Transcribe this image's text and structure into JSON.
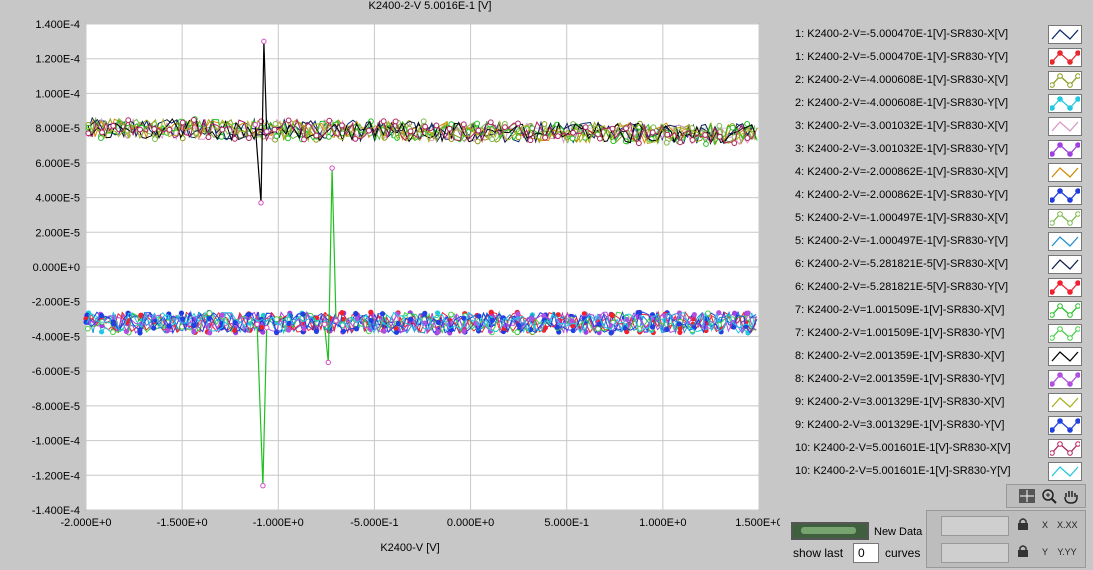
{
  "chart_data": {
    "type": "line",
    "title": "K2400-2-V 5.0016E-1 [V]",
    "xlabel": "K2400-V  [V]",
    "ylabel": "",
    "xlim": [
      -2.0,
      1.5
    ],
    "ylim": [
      -0.00014,
      0.00014
    ],
    "grid": true,
    "x_ticks": [
      "-2.000E+0",
      "-1.500E+0",
      "-1.000E+0",
      "-5.000E-1",
      "0.000E+0",
      "5.000E-1",
      "1.000E+0",
      "1.500E+0"
    ],
    "y_ticks": [
      "1.400E-4",
      "1.200E-4",
      "1.000E-4",
      "8.000E-5",
      "6.000E-5",
      "4.000E-5",
      "2.000E-5",
      "0.000E+0",
      "-2.000E-5",
      "-4.000E-5",
      "-6.000E-5",
      "-8.000E-5",
      "-1.000E-4",
      "-1.200E-4",
      "-1.400E-4"
    ],
    "series": [
      {
        "name": "1: K2400-2-V=-5.000470E-1[V]-SR830-X[V]",
        "color": "#0a2a6e",
        "marker": "none",
        "base": 8e-05
      },
      {
        "name": "1: K2400-2-V=-5.000470E-1[V]-SR830-Y[V]",
        "color": "#e8282c",
        "marker": "dot",
        "base": -3.2e-05
      },
      {
        "name": "2: K2400-2-V=-4.000608E-1[V]-SR830-X[V]",
        "color": "#8a9a16",
        "marker": "ring",
        "base": 8e-05
      },
      {
        "name": "2: K2400-2-V=-4.000608E-1[V]-SR830-Y[V]",
        "color": "#22c8e0",
        "marker": "dot",
        "base": -3.2e-05
      },
      {
        "name": "3: K2400-2-V=-3.001032E-1[V]-SR830-X[V]",
        "color": "#d89ac8",
        "marker": "none",
        "base": 8e-05
      },
      {
        "name": "3: K2400-2-V=-3.001032E-1[V]-SR830-Y[V]",
        "color": "#a040e0",
        "marker": "dot",
        "base": -3.2e-05
      },
      {
        "name": "4: K2400-2-V=-2.000862E-1[V]-SR830-X[V]",
        "color": "#d08a00",
        "marker": "none",
        "base": 8e-05
      },
      {
        "name": "4: K2400-2-V=-2.000862E-1[V]-SR830-Y[V]",
        "color": "#1e3ae0",
        "marker": "dot",
        "base": -3.2e-05
      },
      {
        "name": "5: K2400-2-V=-1.000497E-1[V]-SR830-X[V]",
        "color": "#7ab84a",
        "marker": "ring",
        "base": 8e-05
      },
      {
        "name": "5: K2400-2-V=-1.000497E-1[V]-SR830-Y[V]",
        "color": "#2090d0",
        "marker": "none",
        "base": -3.2e-05
      },
      {
        "name": "6: K2400-2-V=-5.281821E-5[V]-SR830-X[V]",
        "color": "#102050",
        "marker": "none",
        "base": 8e-05
      },
      {
        "name": "6: K2400-2-V=-5.281821E-5[V]-SR830-Y[V]",
        "color": "#f02030",
        "marker": "dot",
        "base": -3.2e-05
      },
      {
        "name": "7: K2400-2-V=1.001509E-1[V]-SR830-X[V]",
        "color": "#20c020",
        "marker": "ring",
        "base": 8e-05
      },
      {
        "name": "7: K2400-2-V=1.001509E-1[V]-SR830-Y[V]",
        "color": "#40d040",
        "marker": "ring",
        "base": -3.2e-05
      },
      {
        "name": "8: K2400-2-V=2.001359E-1[V]-SR830-X[V]",
        "color": "#000000",
        "marker": "none",
        "base": 8e-05
      },
      {
        "name": "8: K2400-2-V=2.001359E-1[V]-SR830-Y[V]",
        "color": "#b050e0",
        "marker": "dot",
        "base": -3.2e-05
      },
      {
        "name": "9: K2400-2-V=3.001329E-1[V]-SR830-X[V]",
        "color": "#a8b020",
        "marker": "none",
        "base": 8e-05
      },
      {
        "name": "9: K2400-2-V=3.001329E-1[V]-SR830-Y[V]",
        "color": "#2040e0",
        "marker": "dot",
        "base": -3.2e-05
      },
      {
        "name": "10: K2400-2-V=5.001601E-1[V]-SR830-X[V]",
        "color": "#b02060",
        "marker": "ring",
        "base": 8e-05
      },
      {
        "name": "10: K2400-2-V=5.001601E-1[V]-SR830-Y[V]",
        "color": "#20c8e0",
        "marker": "none",
        "base": -3.2e-05
      }
    ],
    "spikes": [
      {
        "color": "#000000",
        "points": [
          [
            -1.12,
            8.2e-05
          ],
          [
            -1.09,
            3.7e-05
          ],
          [
            -1.075,
            0.00013
          ],
          [
            -1.06,
            7.8e-05
          ]
        ]
      },
      {
        "color": "#20c020",
        "points": [
          [
            -1.11,
            -3.3e-05
          ],
          [
            -1.08,
            -0.000126
          ],
          [
            -1.06,
            -3.5e-05
          ]
        ]
      },
      {
        "color": "#20c020",
        "points": [
          [
            -0.76,
            -3.3e-05
          ],
          [
            -0.74,
            -5.5e-05
          ],
          [
            -0.72,
            5.7e-05
          ],
          [
            -0.7,
            -3.1e-05
          ]
        ]
      }
    ]
  },
  "controls": {
    "new_data_label": "New Data",
    "show_last_label": "show last",
    "show_last_value": "0",
    "curves_label": "curves",
    "palette_icons": [
      "crosshair-tool",
      "zoom-tool",
      "pan-tool"
    ],
    "scale_x_format": "X.XX",
    "scale_y_format": "Y.YY",
    "scale_x_label": "X",
    "scale_y_label": "Y"
  }
}
